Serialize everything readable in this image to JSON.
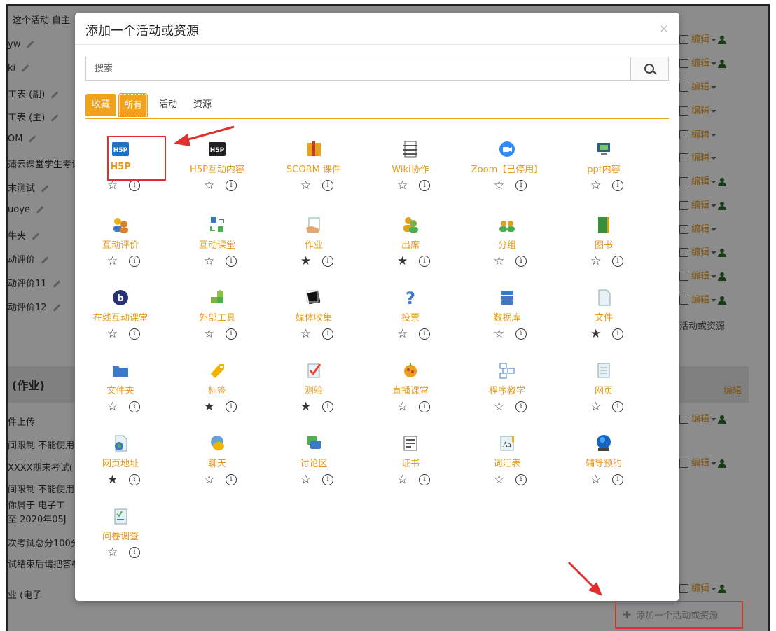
{
  "background": {
    "header_text": "这个活动 自主",
    "rows": [
      "yw",
      "ki",
      "工表 (副)",
      "工表 (主)",
      "OM",
      "蒲云课堂学生考试",
      "末测试",
      "uoye",
      "牛夹",
      "动评价",
      "动评价11",
      "动评价12"
    ],
    "section_title": "(作业)",
    "lower_rows": [
      "件上传",
      "间限制 不能使用",
      "XXXX期末考试(",
      "间限制 不能使用",
      "你属于 电子工",
      "至 2020年05J",
      "次考试总分100分",
      "试结束后请把答卷",
      "业            (电子"
    ],
    "edit_label": "编辑",
    "right_add_text": "活动或资源",
    "add_link_label": "添加一个活动或资源"
  },
  "modal": {
    "title": "添加一个活动或资源",
    "close": "×",
    "search_placeholder": "搜索",
    "search_value": "",
    "tabs": [
      "收藏",
      "所有",
      "活动",
      "资源"
    ],
    "active_tab": "所有",
    "items": [
      {
        "label": "H5P",
        "icon": "h5p-icon",
        "starred": false
      },
      {
        "label": "H5P互动内容",
        "icon": "h5p-dark-icon",
        "starred": false
      },
      {
        "label": "SCORM 课件",
        "icon": "scorm-package-icon",
        "starred": false
      },
      {
        "label": "Wiki协作",
        "icon": "wiki-icon",
        "starred": false
      },
      {
        "label": "Zoom【已停用】",
        "icon": "zoom-camera-icon",
        "starred": false
      },
      {
        "label": "ppt内容",
        "icon": "presentation-icon",
        "starred": false
      },
      {
        "label": "互动评价",
        "icon": "peer-review-icon",
        "starred": false
      },
      {
        "label": "互动课堂",
        "icon": "interactive-class-icon",
        "starred": false
      },
      {
        "label": "作业",
        "icon": "assignment-icon",
        "starred": true
      },
      {
        "label": "出席",
        "icon": "attendance-icon",
        "starred": true
      },
      {
        "label": "分组",
        "icon": "group-icon",
        "starred": false
      },
      {
        "label": "图书",
        "icon": "book-icon",
        "starred": false
      },
      {
        "label": "在线互动课堂",
        "icon": "bigbluebutton-icon",
        "starred": false
      },
      {
        "label": "外部工具",
        "icon": "puzzle-icon",
        "starred": false
      },
      {
        "label": "媒体收集",
        "icon": "media-icon",
        "starred": false
      },
      {
        "label": "投票",
        "icon": "question-icon",
        "starred": false
      },
      {
        "label": "数据库",
        "icon": "database-icon",
        "starred": false
      },
      {
        "label": "文件",
        "icon": "file-icon",
        "starred": true
      },
      {
        "label": "文件夹",
        "icon": "folder-icon",
        "starred": false
      },
      {
        "label": "标签",
        "icon": "tag-icon",
        "starred": true
      },
      {
        "label": "测验",
        "icon": "quiz-icon",
        "starred": true
      },
      {
        "label": "直播课堂",
        "icon": "live-class-icon",
        "starred": false
      },
      {
        "label": "程序教学",
        "icon": "lesson-icon",
        "starred": false
      },
      {
        "label": "网页",
        "icon": "page-icon",
        "starred": false
      },
      {
        "label": "网页地址",
        "icon": "url-icon",
        "starred": true
      },
      {
        "label": "聊天",
        "icon": "chat-icon",
        "starred": false
      },
      {
        "label": "讨论区",
        "icon": "forum-icon",
        "starred": false
      },
      {
        "label": "证书",
        "icon": "certificate-icon",
        "starred": false
      },
      {
        "label": "词汇表",
        "icon": "glossary-icon",
        "starred": false
      },
      {
        "label": "辅导预约",
        "icon": "scheduler-icon",
        "starred": false
      },
      {
        "label": "问卷调查",
        "icon": "survey-icon",
        "starred": false
      }
    ]
  },
  "colors": {
    "accent": "#f0a21a",
    "link_orange": "#e59b1e",
    "highlight_red": "#e0302e"
  }
}
